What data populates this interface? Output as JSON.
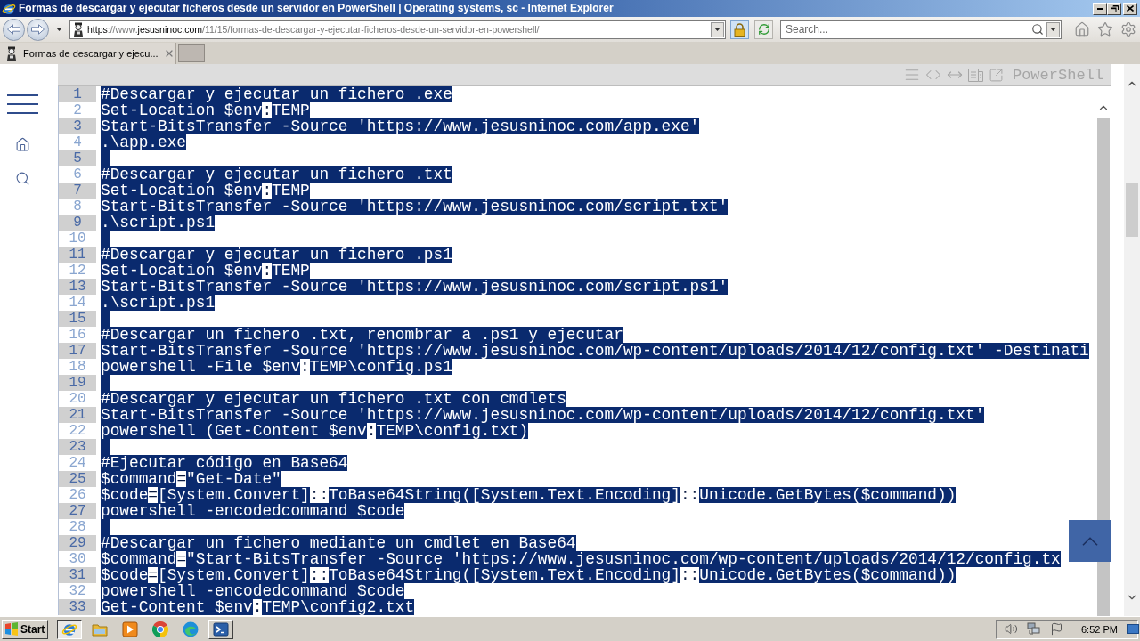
{
  "window": {
    "title": "Formas de descargar y ejecutar ficheros desde un servidor en PowerShell | Operating systems, sc - Internet Explorer"
  },
  "address_bar": {
    "segments": [
      {
        "text": "https",
        "kind": "scheme"
      },
      {
        "text": "://www.",
        "kind": "prefix"
      },
      {
        "text": "jesusninoc.com",
        "kind": "domain"
      },
      {
        "text": "/11/15/formas-de-descargar-y-ejecutar-ficheros-desde-un-servidor-en-powershell/",
        "kind": "path"
      }
    ]
  },
  "search": {
    "placeholder": "Search..."
  },
  "tabs": [
    {
      "label": "Formas de descargar y ejecu...",
      "selected": true
    }
  ],
  "code_block": {
    "language": "PowerShell",
    "lines": [
      {
        "number": "1",
        "segments": [
          {
            "text": "#Descargar y ejecutar un fichero .exe",
            "selected": true
          }
        ]
      },
      {
        "number": "2",
        "segments": [
          {
            "text": "Set-Location $env",
            "selected": true
          },
          {
            "text": ":",
            "selected": false
          },
          {
            "text": "TEMP",
            "selected": true
          }
        ]
      },
      {
        "number": "3",
        "segments": [
          {
            "text": "Start-BitsTransfer -Source 'https://www.jesusninoc.com/app.exe'",
            "selected": true
          }
        ]
      },
      {
        "number": "4",
        "segments": [
          {
            "text": ".\\app.exe",
            "selected": true
          }
        ]
      },
      {
        "number": "5",
        "selected": true
      },
      {
        "number": "6",
        "segments": [
          {
            "text": "#Descargar y ejecutar un fichero .txt",
            "selected": true
          }
        ]
      },
      {
        "number": "7",
        "segments": [
          {
            "text": "Set-Location $env",
            "selected": true
          },
          {
            "text": ":",
            "selected": false
          },
          {
            "text": "TEMP",
            "selected": true
          }
        ]
      },
      {
        "number": "8",
        "segments": [
          {
            "text": "Start-BitsTransfer -Source 'https://www.jesusninoc.com/script.txt'",
            "selected": true
          }
        ]
      },
      {
        "number": "9",
        "segments": [
          {
            "text": ".\\script.ps1",
            "selected": true
          }
        ]
      },
      {
        "number": "10",
        "selected": true
      },
      {
        "number": "11",
        "segments": [
          {
            "text": "#Descargar y ejecutar un fichero .ps1",
            "selected": true
          }
        ]
      },
      {
        "number": "12",
        "segments": [
          {
            "text": "Set-Location $env",
            "selected": true
          },
          {
            "text": ":",
            "selected": false
          },
          {
            "text": "TEMP",
            "selected": true
          }
        ]
      },
      {
        "number": "13",
        "segments": [
          {
            "text": "Start-BitsTransfer -Source 'https://www.jesusninoc.com/script.ps1'",
            "selected": true
          }
        ]
      },
      {
        "number": "14",
        "segments": [
          {
            "text": ".\\script.ps1",
            "selected": true
          }
        ]
      },
      {
        "number": "15",
        "selected": true
      },
      {
        "number": "16",
        "segments": [
          {
            "text": "#Descargar un fichero .txt, renombrar a .ps1 y ejecutar",
            "selected": true
          }
        ]
      },
      {
        "number": "17",
        "segments": [
          {
            "text": "Start-BitsTransfer -Source 'https://www.jesusninoc.com/wp-content/uploads/2014/12/config.txt' -Destinati",
            "selected": true
          }
        ]
      },
      {
        "number": "18",
        "segments": [
          {
            "text": "powershell -File $env",
            "selected": true
          },
          {
            "text": ":",
            "selected": false
          },
          {
            "text": "TEMP\\config.ps1",
            "selected": true
          }
        ]
      },
      {
        "number": "19",
        "selected": true
      },
      {
        "number": "20",
        "segments": [
          {
            "text": "#Descargar y ejecutar un fichero .txt con cmdlets",
            "selected": true
          }
        ]
      },
      {
        "number": "21",
        "segments": [
          {
            "text": "Start-BitsTransfer -Source 'https://www.jesusninoc.com/wp-content/uploads/2014/12/config.txt'",
            "selected": true
          }
        ]
      },
      {
        "number": "22",
        "segments": [
          {
            "text": "powershell (Get-Content $env",
            "selected": true
          },
          {
            "text": ":",
            "selected": false
          },
          {
            "text": "TEMP\\config.txt)",
            "selected": true
          }
        ]
      },
      {
        "number": "23",
        "selected": true
      },
      {
        "number": "24",
        "segments": [
          {
            "text": "#Ejecutar código en Base64",
            "selected": true
          }
        ]
      },
      {
        "number": "25",
        "segments": [
          {
            "text": "$command",
            "selected": true
          },
          {
            "text": "=",
            "selected": false
          },
          {
            "text": "\"Get-Date\"",
            "selected": true
          }
        ]
      },
      {
        "number": "26",
        "segments": [
          {
            "text": "$code",
            "selected": true
          },
          {
            "text": "=",
            "selected": false
          },
          {
            "text": "[System.Convert]",
            "selected": true
          },
          {
            "text": "::",
            "selected": false
          },
          {
            "text": "ToBase64String([System.Text.Encoding]",
            "selected": true
          },
          {
            "text": "::",
            "selected": false
          },
          {
            "text": "Unicode.GetBytes($command))",
            "selected": true
          }
        ]
      },
      {
        "number": "27",
        "segments": [
          {
            "text": "powershell -encodedcommand $code",
            "selected": true
          }
        ]
      },
      {
        "number": "28",
        "selected": true
      },
      {
        "number": "29",
        "segments": [
          {
            "text": "#Descargar un fichero mediante un cmdlet en Base64",
            "selected": true
          }
        ]
      },
      {
        "number": "30",
        "segments": [
          {
            "text": "$command",
            "selected": true
          },
          {
            "text": "=",
            "selected": false
          },
          {
            "text": "\"Start-BitsTransfer -Source 'https://www.jesusninoc.com/wp-content/uploads/2014/12/config.tx",
            "selected": true
          }
        ]
      },
      {
        "number": "31",
        "segments": [
          {
            "text": "$code",
            "selected": true
          },
          {
            "text": "=",
            "selected": false
          },
          {
            "text": "[System.Convert]",
            "selected": true
          },
          {
            "text": "::",
            "selected": false
          },
          {
            "text": "ToBase64String([System.Text.Encoding]",
            "selected": true
          },
          {
            "text": "::",
            "selected": false
          },
          {
            "text": "Unicode.GetBytes($command))",
            "selected": true
          }
        ]
      },
      {
        "number": "32",
        "segments": [
          {
            "text": "powershell -encodedcommand $code",
            "selected": true
          }
        ]
      },
      {
        "number": "33",
        "segments": [
          {
            "text": "Get-Content $env",
            "selected": true
          },
          {
            "text": ":",
            "selected": false
          },
          {
            "text": "TEMP\\config2.txt",
            "selected": true
          }
        ]
      }
    ]
  },
  "taskbar": {
    "start": "Start",
    "items": [
      {
        "kind": "window",
        "selected": true
      },
      {
        "kind": "pinned",
        "selected": false
      },
      {
        "kind": "pinned",
        "selected": false
      },
      {
        "kind": "pinned",
        "selected": false
      },
      {
        "kind": "pinned",
        "selected": false
      },
      {
        "kind": "window",
        "selected": false
      }
    ],
    "clock": "6:52 PM"
  }
}
